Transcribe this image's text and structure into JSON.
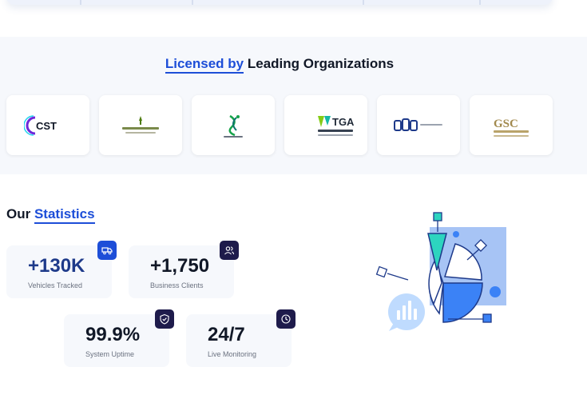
{
  "licensed": {
    "title_highlight": "Licensed by",
    "title_rest": " Leading Organizations",
    "logos": [
      {
        "icon": "cst-logo",
        "text": "CST"
      },
      {
        "icon": "ministry-logo",
        "text": ""
      },
      {
        "icon": "emblem-logo",
        "text": ""
      },
      {
        "icon": "tga-logo",
        "text": "TGA"
      },
      {
        "icon": "org-logo",
        "text": ""
      },
      {
        "icon": "gsc-logo",
        "text": "GSC"
      }
    ]
  },
  "stats": {
    "title_plain": "Our ",
    "title_highlight": "Statistics",
    "items": [
      {
        "value": "+130K",
        "label": "Vehicles Tracked",
        "icon": "truck-icon"
      },
      {
        "value": "+1,750",
        "label": "Business Clients",
        "icon": "users-icon"
      },
      {
        "value": "99.9%",
        "label": "System Uptime",
        "icon": "shield-check-icon"
      },
      {
        "value": "24/7",
        "label": "Live Monitoring",
        "icon": "clock-icon"
      }
    ]
  },
  "colors": {
    "accent": "#1d4ed8",
    "navy": "#1e1b4b",
    "card_bg": "#f6f8fc"
  }
}
